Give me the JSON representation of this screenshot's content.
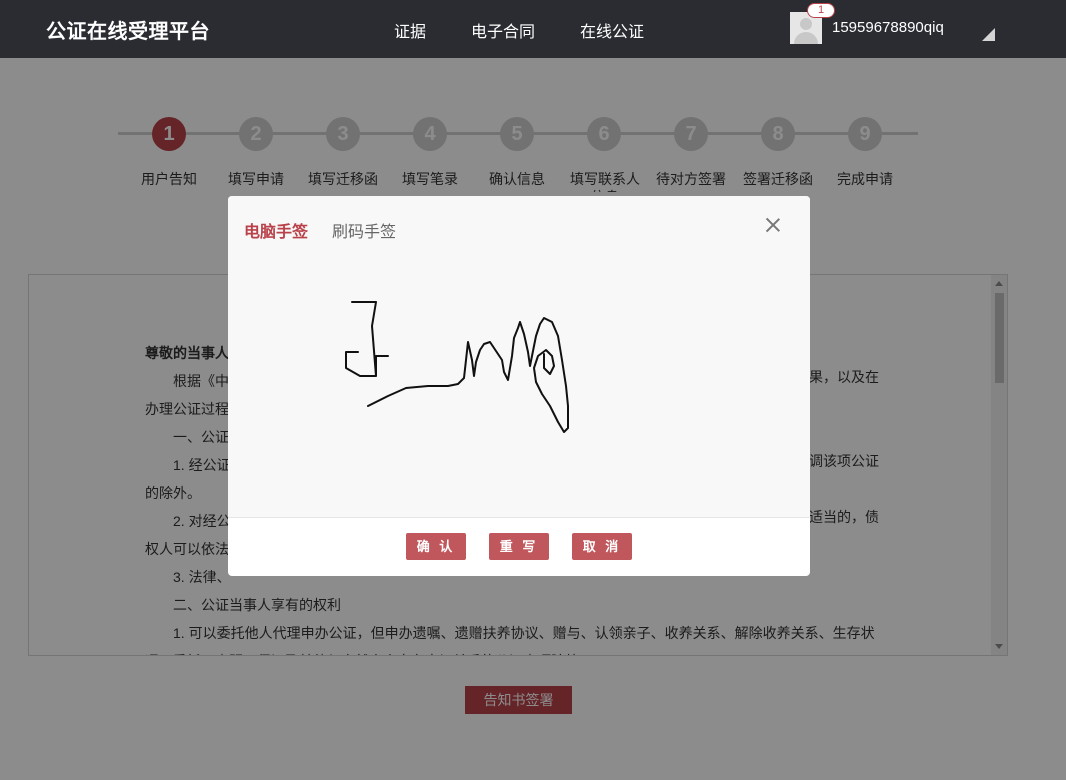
{
  "header": {
    "brand": "公证在线受理平台",
    "nav": [
      "证据",
      "电子合同",
      "在线公证"
    ],
    "notification_count": "1",
    "username": "15959678890qiq"
  },
  "steps": [
    {
      "number": "1",
      "label": "用户告知",
      "active": true
    },
    {
      "number": "2",
      "label": "填写申请",
      "active": false
    },
    {
      "number": "3",
      "label": "填写迁移函",
      "active": false
    },
    {
      "number": "4",
      "label": "填写笔录",
      "active": false
    },
    {
      "number": "5",
      "label": "确认信息",
      "active": false
    },
    {
      "number": "6",
      "label": "填写联系人信息",
      "active": false
    },
    {
      "number": "7",
      "label": "待对方签署",
      "active": false
    },
    {
      "number": "8",
      "label": "签署迁移函",
      "active": false
    },
    {
      "number": "9",
      "label": "完成申请",
      "active": false
    }
  ],
  "document": {
    "lines": [
      {
        "text": "尊敬的当事人",
        "style": "bold"
      },
      {
        "text": "根据《中",
        "style": "indent"
      },
      {
        "text": "办理公证过程",
        "style": "plain"
      },
      {
        "text": "一、公证",
        "style": "indent"
      },
      {
        "text": "1. 经公证",
        "style": "indent"
      },
      {
        "text": "的除外。",
        "style": "plain"
      },
      {
        "text": "2. 对经公",
        "style": "indent"
      },
      {
        "text": "权人可以依法",
        "style": "plain"
      },
      {
        "text": "3. 法律、",
        "style": "indent"
      },
      {
        "text": "二、公证当事人享有的权利",
        "style": "indent"
      },
      {
        "text": "1. 可以委托他人代理申办公证，但申办遗嘱、遗赠扶养协议、赠与、认领亲子、收养关系、解除收养关系、生存状",
        "style": "indent"
      },
      {
        "text": "况、委托、声明、保证及其他与自然人人身有密切关系的公证事项除外；",
        "style": "plain"
      }
    ],
    "right_fragments": [
      {
        "text": "果，以及在",
        "line": 1
      },
      {
        "text": "调该项公证",
        "line": 4
      },
      {
        "text": "适当的，债",
        "line": 6
      }
    ]
  },
  "sign_button": "告知书签署",
  "modal": {
    "tabs": [
      "电脑手签",
      "刷码手签"
    ],
    "active_tab": "电脑手签",
    "buttons": [
      "确 认",
      "重 写",
      "取 消"
    ]
  },
  "colors": {
    "accent": "#b9424a",
    "header_bg": "#2a2c31",
    "step_inactive": "#cfcfcf"
  }
}
